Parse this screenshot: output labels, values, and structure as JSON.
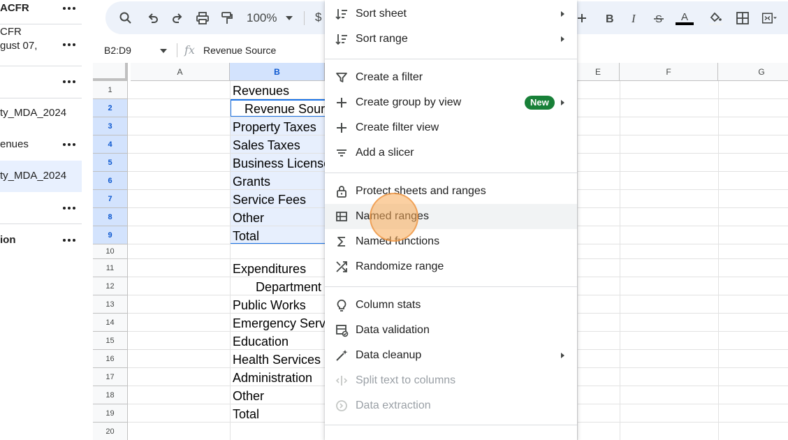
{
  "sidebar": {
    "items": [
      {
        "text": "ACFR",
        "bold": true
      },
      {
        "text": "CFR"
      },
      {
        "text": "gust 07,"
      },
      {
        "text": ""
      },
      {
        "text": "ty_MDA_2024"
      },
      {
        "text": "enues"
      },
      {
        "text": "ty_MDA_2024",
        "selected": true
      },
      {
        "text": ""
      },
      {
        "text": "ion",
        "bold": true
      }
    ]
  },
  "toolbar": {
    "zoom": "100%",
    "currency": "$",
    "icons": [
      "search-icon",
      "undo-icon",
      "redo-icon",
      "print-icon",
      "paint-format-icon",
      "plus-icon",
      "bold-icon",
      "italic-icon",
      "strikethrough-icon",
      "text-color-icon",
      "fill-color-icon",
      "borders-icon",
      "merge-cells-icon"
    ]
  },
  "formula_bar": {
    "range": "B2:D9",
    "fx": "fx",
    "content": "Revenue Source"
  },
  "grid": {
    "columns": [
      "A",
      "B",
      "E",
      "F",
      "G"
    ],
    "rows": [
      "1",
      "2",
      "3",
      "4",
      "5",
      "6",
      "7",
      "8",
      "9",
      "10",
      "11",
      "12",
      "13",
      "14",
      "15",
      "16",
      "17",
      "18",
      "19",
      "20"
    ],
    "col_b_cells": [
      "Revenues",
      "Revenue Sour",
      "Property Taxes",
      "Sales Taxes",
      "Business License",
      "Grants",
      "Service Fees",
      "Other",
      "Total",
      "",
      "Expenditures",
      "Department",
      "Public Works",
      "Emergency Serv",
      "Education",
      "Health Services",
      "Administration",
      "Other",
      "Total",
      ""
    ]
  },
  "menu": {
    "items": [
      {
        "label": "Sort sheet",
        "icon": "sort-sheet-icon",
        "submenu": true
      },
      {
        "label": "Sort range",
        "icon": "sort-range-icon",
        "submenu": true
      },
      {
        "label": "Create a filter",
        "icon": "filter-icon"
      },
      {
        "label": "Create group by view",
        "icon": "plus-icon",
        "badge": "New",
        "submenu": true
      },
      {
        "label": "Create filter view",
        "icon": "plus-icon"
      },
      {
        "label": "Add a slicer",
        "icon": "slicer-icon"
      },
      {
        "label": "Protect sheets and ranges",
        "icon": "lock-icon"
      },
      {
        "label": "Named ranges",
        "icon": "named-ranges-icon",
        "highlighted": true
      },
      {
        "label": "Named functions",
        "icon": "sigma-icon"
      },
      {
        "label": "Randomize range",
        "icon": "shuffle-icon"
      },
      {
        "label": "Column stats",
        "icon": "lightbulb-icon"
      },
      {
        "label": "Data validation",
        "icon": "data-validation-icon"
      },
      {
        "label": "Data cleanup",
        "icon": "magic-wand-icon",
        "submenu": true
      },
      {
        "label": "Split text to columns",
        "icon": "split-icon",
        "disabled": true
      },
      {
        "label": "Data extraction",
        "icon": "extract-icon",
        "disabled": true
      }
    ]
  },
  "colors": {
    "accent": "#1a73e8",
    "selection": "#d3e3fd",
    "badge": "#188038",
    "click_indicator": "#f7a956"
  }
}
